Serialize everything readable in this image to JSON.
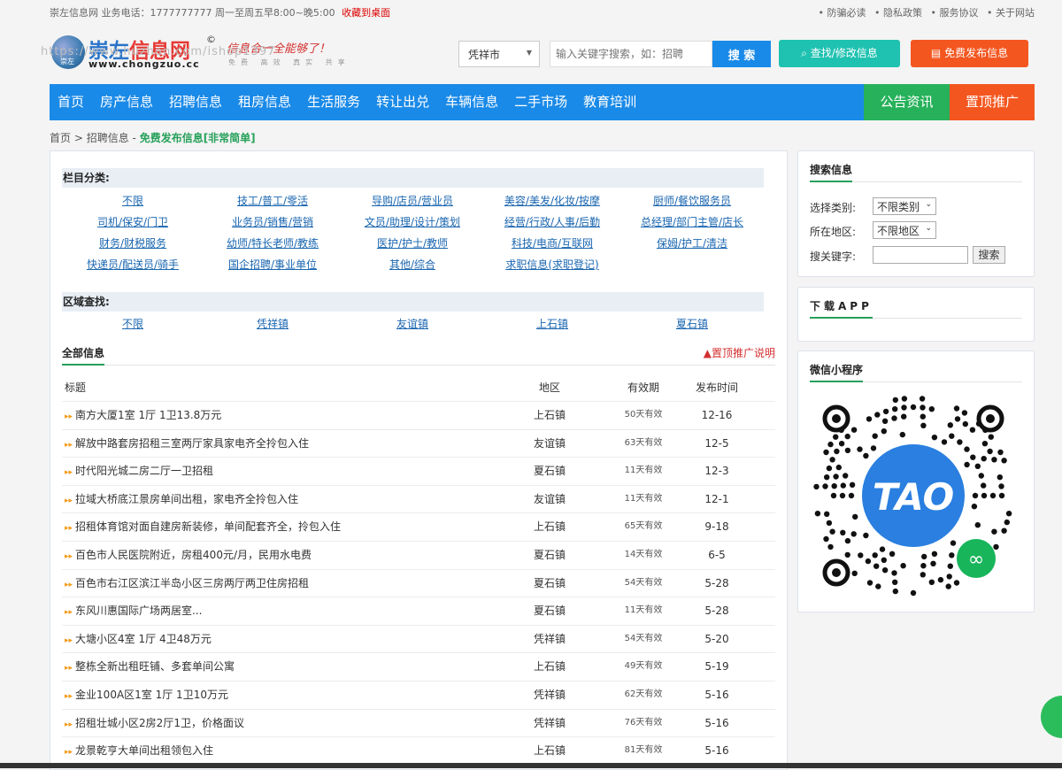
{
  "topbar": {
    "info": "崇左信息网 业务电话：1777777777 周一至周五早8:00~晚5:00",
    "favorite": "收藏到桌面",
    "links": [
      "• 防骗必读",
      "• 隐私政策",
      "• 服务协议",
      "• 关于网站"
    ]
  },
  "logo": {
    "cn_blue": "崇左",
    "cn_red": "信息网",
    "reg": "©",
    "globe_text": "崇左",
    "url": "www.chongzuo.cc",
    "slogan": "信息合一全能够了！",
    "slogan_sub": "免费 高效 真实 共享",
    "watermark": "https://www.huzhan.com/ishop1397"
  },
  "header": {
    "city": "凭祥市",
    "search_placeholder": "输入关键字搜索，如：招聘",
    "search_btn": "搜 索",
    "find_btn": "查找/修改信息",
    "publish_btn": "免费发布信息"
  },
  "nav": {
    "items": [
      "首页",
      "房产信息",
      "招聘信息",
      "租房信息",
      "生活服务",
      "转让出兑",
      "车辆信息",
      "二手市场",
      "教育培训"
    ],
    "notice": "公告资讯",
    "promo": "置顶推广"
  },
  "breadcrumb": {
    "home": "首页",
    "sep1": " > ",
    "section": "招聘信息",
    "sep2": " - ",
    "highlight": "免费发布信息[非常简单]"
  },
  "categories": {
    "title": "栏目分类:",
    "rows": [
      [
        "不限",
        "技工/普工/零活",
        "导购/店员/营业员",
        "美容/美发/化妆/按摩",
        "厨师/餐饮服务员"
      ],
      [
        "司机/保安/门卫",
        "业务员/销售/营销",
        "文员/助理/设计/策划",
        "经营/行政/人事/后勤",
        "总经理/部门主管/店长"
      ],
      [
        "财务/财税服务",
        "幼师/特长老师/教练",
        "医护/护士/教师",
        "科技/电商/互联网",
        "保姆/护工/清洁"
      ],
      [
        "快递员/配送员/骑手",
        "国企招聘/事业单位",
        "其他/综合",
        "求职信息(求职登记)",
        ""
      ]
    ]
  },
  "area": {
    "title": "区域查找:",
    "items": [
      "不限",
      "凭祥镇",
      "友谊镇",
      "上石镇",
      "夏石镇"
    ]
  },
  "list": {
    "title": "全部信息",
    "promo_note": "▲置顶推广说明",
    "headers": [
      "标题",
      "地区",
      "有效期",
      "发布时间"
    ],
    "rows": [
      [
        "南方大厦1室 1厅 1卫13.8万元",
        "上石镇",
        "50天有效",
        "12-16"
      ],
      [
        "解放中路套房招租三室两厅家具家电齐全拎包入住",
        "友谊镇",
        "63天有效",
        "12-5"
      ],
      [
        "时代阳光城二房二厅一卫招租",
        "夏石镇",
        "11天有效",
        "12-3"
      ],
      [
        "拉域大桥底江景房单间出租，家电齐全拎包入住",
        "友谊镇",
        "11天有效",
        "12-1"
      ],
      [
        "招租体育馆对面自建房新装修，单间配套齐全，拎包入住",
        "上石镇",
        "65天有效",
        "9-18"
      ],
      [
        "百色市人民医院附近，房租400元/月，民用水电费",
        "夏石镇",
        "14天有效",
        "6-5"
      ],
      [
        "百色市右江区滨江半岛小区三房两厅两卫住房招租",
        "夏石镇",
        "54天有效",
        "5-28"
      ],
      [
        "东风川惠国际广场两居室...",
        "夏石镇",
        "11天有效",
        "5-28"
      ],
      [
        "大塘小区4室 1厅 4卫48万元",
        "凭祥镇",
        "54天有效",
        "5-20"
      ],
      [
        "整栋全新出租旺铺、多套单间公寓",
        "上石镇",
        "49天有效",
        "5-19"
      ],
      [
        "金业100A区1室 1厅 1卫10万元",
        "凭祥镇",
        "62天有效",
        "5-16"
      ],
      [
        "招租壮城小区2房2厅1卫，价格面议",
        "凭祥镇",
        "76天有效",
        "5-16"
      ],
      [
        "龙景乾亨大单间出租领包入住",
        "上石镇",
        "81天有效",
        "5-16"
      ]
    ]
  },
  "sidebar": {
    "search_title": "搜索信息",
    "type_label": "选择类别:",
    "type_value": "不限类别",
    "area_label": "所在地区:",
    "area_value": "不限地区",
    "kw_label": "搜关键字:",
    "kw_btn": "搜索",
    "app_title": "下载APP",
    "mini_title": "微信小程序",
    "qr_text": "TAO"
  },
  "colors": {
    "nav_blue": "#1a8ae8",
    "notice_green": "#26b15a",
    "promo_orange": "#f4561f",
    "find_teal": "#1fc2b0",
    "link_blue": "#1a66b0"
  }
}
